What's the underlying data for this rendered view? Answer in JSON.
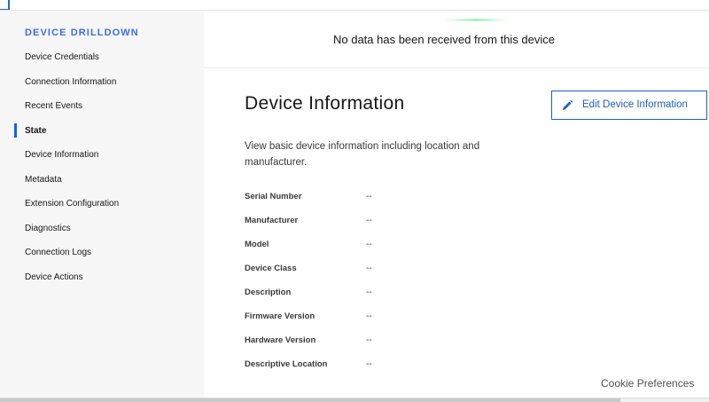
{
  "sidebar": {
    "title": "DEVICE DRILLDOWN",
    "active_index": 3,
    "items": [
      {
        "label": "Device Credentials"
      },
      {
        "label": "Connection Information"
      },
      {
        "label": "Recent Events"
      },
      {
        "label": "State"
      },
      {
        "label": "Device Information"
      },
      {
        "label": "Metadata"
      },
      {
        "label": "Extension Configuration"
      },
      {
        "label": "Diagnostics"
      },
      {
        "label": "Connection Logs"
      },
      {
        "label": "Device Actions"
      }
    ]
  },
  "notice": {
    "text": "No data has been received from this device"
  },
  "main": {
    "title": "Device Information",
    "description": "View basic device information including location and manufacturer.",
    "edit_button_label": "Edit Device Information",
    "edit_icon": "pencil-icon",
    "fields": [
      {
        "label": "Serial Number",
        "value": "--"
      },
      {
        "label": "Manufacturer",
        "value": "--"
      },
      {
        "label": "Model",
        "value": "--"
      },
      {
        "label": "Device Class",
        "value": "--"
      },
      {
        "label": "Description",
        "value": "--"
      },
      {
        "label": "Firmware Version",
        "value": "--"
      },
      {
        "label": "Hardware Version",
        "value": "--"
      },
      {
        "label": "Descriptive Location",
        "value": "--"
      }
    ]
  },
  "footer": {
    "cookie_label": "Cookie Preferences"
  },
  "colors": {
    "accent": "#3c6df0",
    "button_border": "#1f5fbf",
    "sidebar_bg": "#f7f7f7"
  }
}
